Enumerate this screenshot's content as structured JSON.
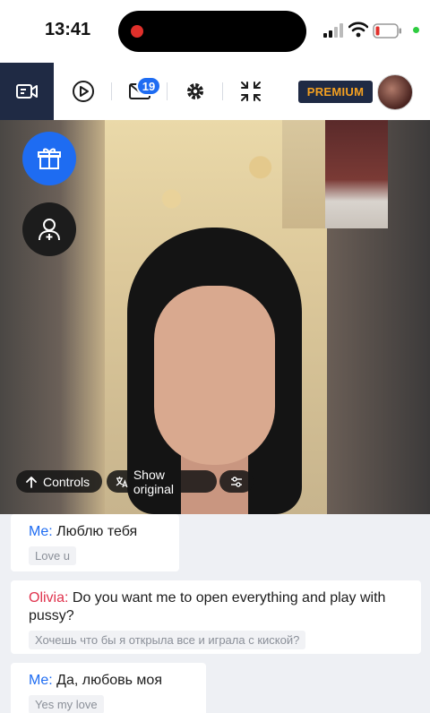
{
  "status_bar": {
    "time": "13:41"
  },
  "toolbar": {
    "items": [
      {
        "name": "video-chat",
        "active": true
      },
      {
        "name": "play"
      },
      {
        "name": "messages",
        "badge": "19"
      },
      {
        "name": "settings"
      },
      {
        "name": "minimize"
      }
    ],
    "premium_label": "PREMIUM"
  },
  "video": {
    "controls_label": "Controls",
    "show_original_label": "Show original"
  },
  "chat": {
    "messages": [
      {
        "sender": "Me:",
        "text": "Люблю тебя",
        "translation": "Love u"
      },
      {
        "sender": "Olivia:",
        "text": "Do you want me to open everything and play with pussy?",
        "translation": "Хочешь что бы я открыла все и играла с киской?"
      },
      {
        "sender": "Me:",
        "text": "Да, любовь моя",
        "translation": "Yes my love"
      }
    ]
  },
  "colors": {
    "accent": "#1e6cf2",
    "toolbar_dark": "#1f2a44",
    "premium_text": "#f4a020",
    "other_sender": "#e0334d"
  }
}
